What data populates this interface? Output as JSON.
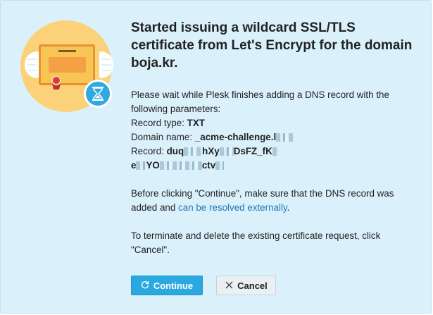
{
  "dialog": {
    "title": "Started issuing a wildcard SSL/TLS certificate from Let's Encrypt for the domain boja.kr.",
    "intro": "Please wait while Plesk finishes adding a DNS record with the following parameters:",
    "record_type_label": "Record type:",
    "record_type_value": "TXT",
    "domain_name_label": "Domain name:",
    "domain_name_value": "_acme-challenge.l",
    "record_label": "Record:",
    "record_value_1": "duq",
    "record_value_2": "hXy",
    "record_value_3": "DsFZ_fK",
    "record_value_4": "e",
    "record_value_5": "YO",
    "record_value_6": "ctv",
    "before_text": "Before clicking \"Continue\", make sure that the DNS record was added and",
    "resolve_link": "can be resolved externally",
    "after_link": ".",
    "terminate_text": "To terminate and delete the existing certificate request, click \"Cancel\"."
  },
  "buttons": {
    "continue_label": "Continue",
    "cancel_label": "Cancel"
  },
  "colors": {
    "background": "#daf1fc",
    "primary": "#29a9df",
    "link": "#2077b8"
  },
  "icons": {
    "continue": "refresh-icon",
    "cancel": "close-icon",
    "illustration": "certificate-illustration"
  }
}
